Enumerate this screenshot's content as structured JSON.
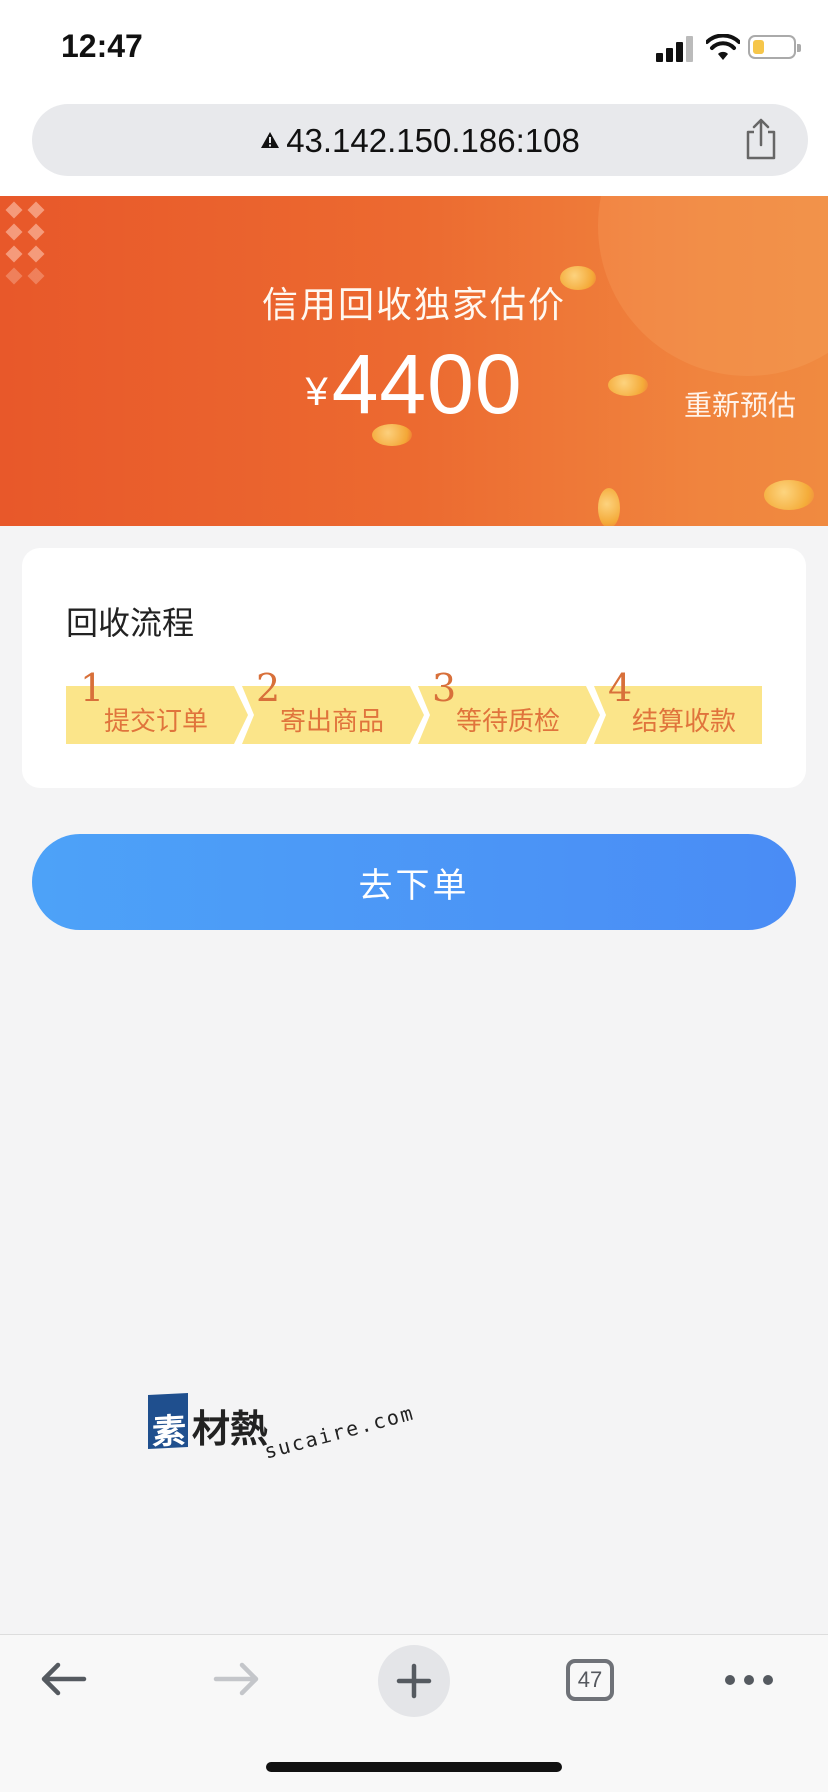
{
  "status_bar": {
    "time": "12:47",
    "battery_color": "#f6c64a",
    "battery_level": 0.3
  },
  "browser": {
    "url": "43.142.150.186:108",
    "warning_icon": "warning-triangle-icon",
    "share_icon": "share-icon"
  },
  "banner": {
    "title": "信用回收独家估价",
    "price_symbol": "¥",
    "price_value": "4400",
    "reestimate_label": "重新预估",
    "background_color": "#e8582a"
  },
  "process": {
    "title": "回收流程",
    "steps": [
      {
        "number": "1",
        "label": "提交订单"
      },
      {
        "number": "2",
        "label": "寄出商品"
      },
      {
        "number": "3",
        "label": "等待质检"
      },
      {
        "number": "4",
        "label": "结算收款"
      }
    ],
    "step_color": "#fbe58a"
  },
  "order_button": {
    "label": "去下单",
    "color": "#4a8cf5"
  },
  "watermark": {
    "logo_char": "素",
    "text": "材熱",
    "domain": "sucaire.com"
  },
  "toolbar": {
    "back_icon": "arrow-left-icon",
    "forward_icon": "arrow-right-icon",
    "new_tab_icon": "plus-icon",
    "tabs_count": "47",
    "more_icon": "ellipsis-icon"
  }
}
